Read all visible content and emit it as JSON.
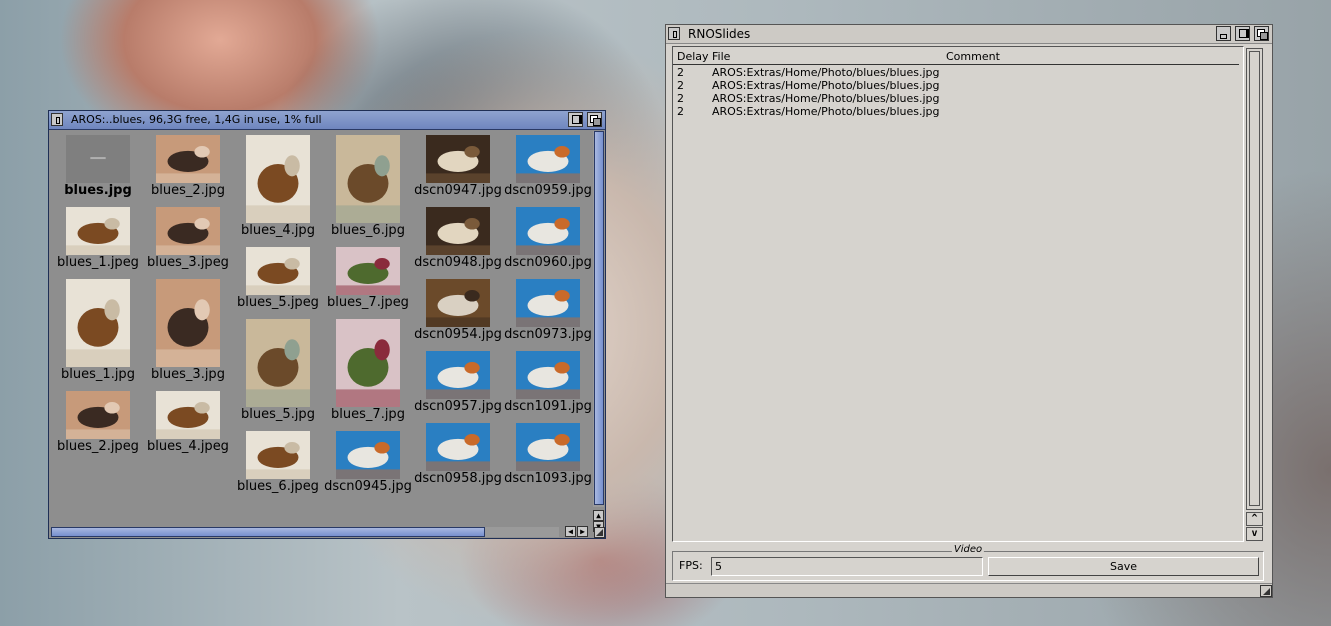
{
  "drawer": {
    "title": "AROS:..blues,  96,3G free, 1,4G in use, 1% full",
    "icons": [
      {
        "label": "blues.jpg",
        "selected": true,
        "kind": "tile"
      },
      {
        "label": "blues_1.jpeg",
        "kind": "dog-white"
      },
      {
        "label": "blues_1.jpg",
        "kind": "dog-white"
      },
      {
        "label": "blues_2.jpeg",
        "kind": "person"
      },
      {
        "label": "blues_2.jpg",
        "kind": "person"
      },
      {
        "label": "blues_3.jpeg",
        "kind": "person"
      },
      {
        "label": "blues_3.jpg",
        "kind": "person"
      },
      {
        "label": "blues_4.jpeg",
        "kind": "dog-white"
      },
      {
        "label": "blues_4.jpg",
        "kind": "dog-white"
      },
      {
        "label": "blues_5.jpeg",
        "kind": "dog-white"
      },
      {
        "label": "blues_5.jpg",
        "kind": "dog-blanket"
      },
      {
        "label": "blues_6.jpeg",
        "kind": "dog-white"
      },
      {
        "label": "blues_6.jpg",
        "kind": "dog-blanket"
      },
      {
        "label": "blues_7.jpeg",
        "kind": "garden"
      },
      {
        "label": "blues_7.jpg",
        "kind": "garden"
      },
      {
        "label": "dscn0945.jpg",
        "kind": "dog-blue"
      },
      {
        "label": "dscn0947.jpg",
        "kind": "dog-dark"
      },
      {
        "label": "dscn0948.jpg",
        "kind": "dog-dark"
      },
      {
        "label": "dscn0954.jpg",
        "kind": "dog-floor"
      },
      {
        "label": "dscn0957.jpg",
        "kind": "dog-blue"
      },
      {
        "label": "dscn0958.jpg",
        "kind": "dog-blue"
      },
      {
        "label": "dscn0959.jpg",
        "kind": "dog-blue"
      },
      {
        "label": "dscn0960.jpg",
        "kind": "dog-blue"
      },
      {
        "label": "dscn0973.jpg",
        "kind": "dog-blue"
      },
      {
        "label": "dscn1091.jpg",
        "kind": "dog-blue"
      },
      {
        "label": "dscn1093.jpg",
        "kind": "dog-blue"
      }
    ]
  },
  "rno": {
    "title": "RNOSlides",
    "columns": {
      "delay": "Delay",
      "file": "File",
      "comment": "Comment"
    },
    "rows": [
      {
        "delay": "2",
        "file": "AROS:Extras/Home/Photo/blues/blues.jpg",
        "comment": ""
      },
      {
        "delay": "2",
        "file": "AROS:Extras/Home/Photo/blues/blues.jpg",
        "comment": ""
      },
      {
        "delay": "2",
        "file": "AROS:Extras/Home/Photo/blues/blues.jpg",
        "comment": ""
      },
      {
        "delay": "2",
        "file": "AROS:Extras/Home/Photo/blues/blues.jpg",
        "comment": ""
      }
    ],
    "group_title": "Video",
    "fps_label": "FPS:",
    "fps_value": "5",
    "save_label": "Save",
    "scroll_up": "^",
    "scroll_down": "v"
  },
  "icons": {
    "drawer_close": "close-gadget-icon",
    "drawer_zoom": "zoom-gadget-icon",
    "drawer_depth": "depth-gadget-icon",
    "rno_iconify": "iconify-gadget-icon"
  },
  "colors": {
    "drawer_title": "#7b90c6",
    "drawer_bg": "#8e8e8e",
    "panel_bg": "#d6d3ce"
  }
}
